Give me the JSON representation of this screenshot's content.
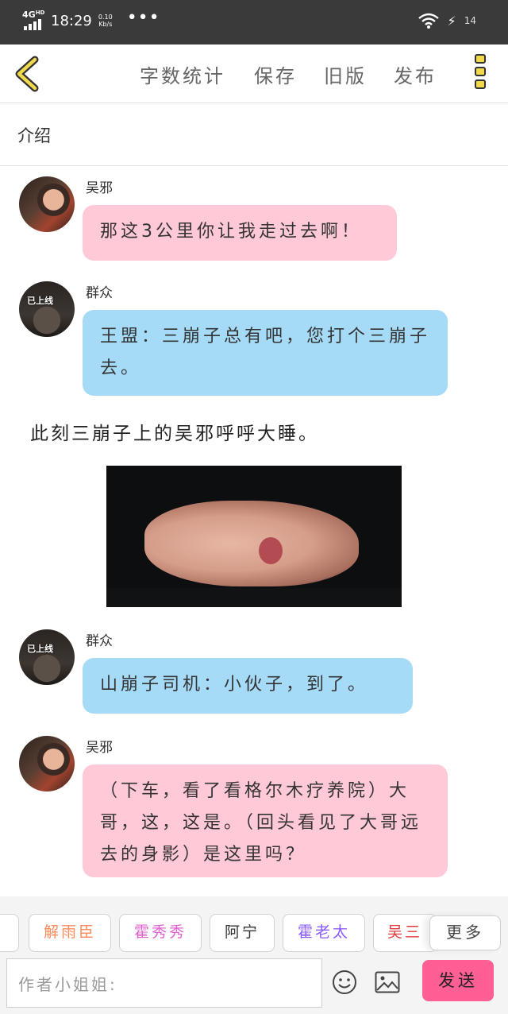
{
  "status_bar": {
    "network": "4G",
    "hd": "HD",
    "time": "18:29",
    "speed_value": "0.10",
    "speed_unit": "Kb/s",
    "dots": "•••",
    "battery": "14"
  },
  "toolbar": {
    "word_count": "字数统计",
    "save": "保存",
    "old_version": "旧版",
    "publish": "发布"
  },
  "intro": {
    "label": "介绍"
  },
  "messages": [
    {
      "speaker": "吴邪",
      "text": "那这3公里你让我走过去啊！"
    },
    {
      "speaker": "群众",
      "avatar_badge": "已上线",
      "text": "王盟：三崩子总有吧，您打个三崩子去。"
    },
    {
      "narration": "此刻三崩子上的吴邪呼呼大睡。"
    },
    {
      "speaker": "群众",
      "avatar_badge": "已上线",
      "text": "山崩子司机：小伙子，到了。"
    },
    {
      "speaker": "吴邪",
      "text": "（下车，看了看格尔木疗养院）大哥，这，这是。（回头看见了大哥远去的身影）是这里吗？"
    }
  ],
  "characters": [
    {
      "label": "",
      "color": "#ff8a5c"
    },
    {
      "label": "解雨臣",
      "color": "#ff8a5c"
    },
    {
      "label": "霍秀秀",
      "color": "#e060d0"
    },
    {
      "label": "阿宁",
      "color": "#333333"
    },
    {
      "label": "霍老太",
      "color": "#8a5cff"
    },
    {
      "label": "吴三",
      "color": "#e23a3a"
    }
  ],
  "more_button": "更多",
  "composer": {
    "placeholder": "作者小姐姐:",
    "send": "发送"
  },
  "colors": {
    "pink_bubble": "#ffc9d8",
    "blue_bubble": "#a6dbf8",
    "send_button": "#ff5f95",
    "menu_accent": "#f1d94c"
  }
}
